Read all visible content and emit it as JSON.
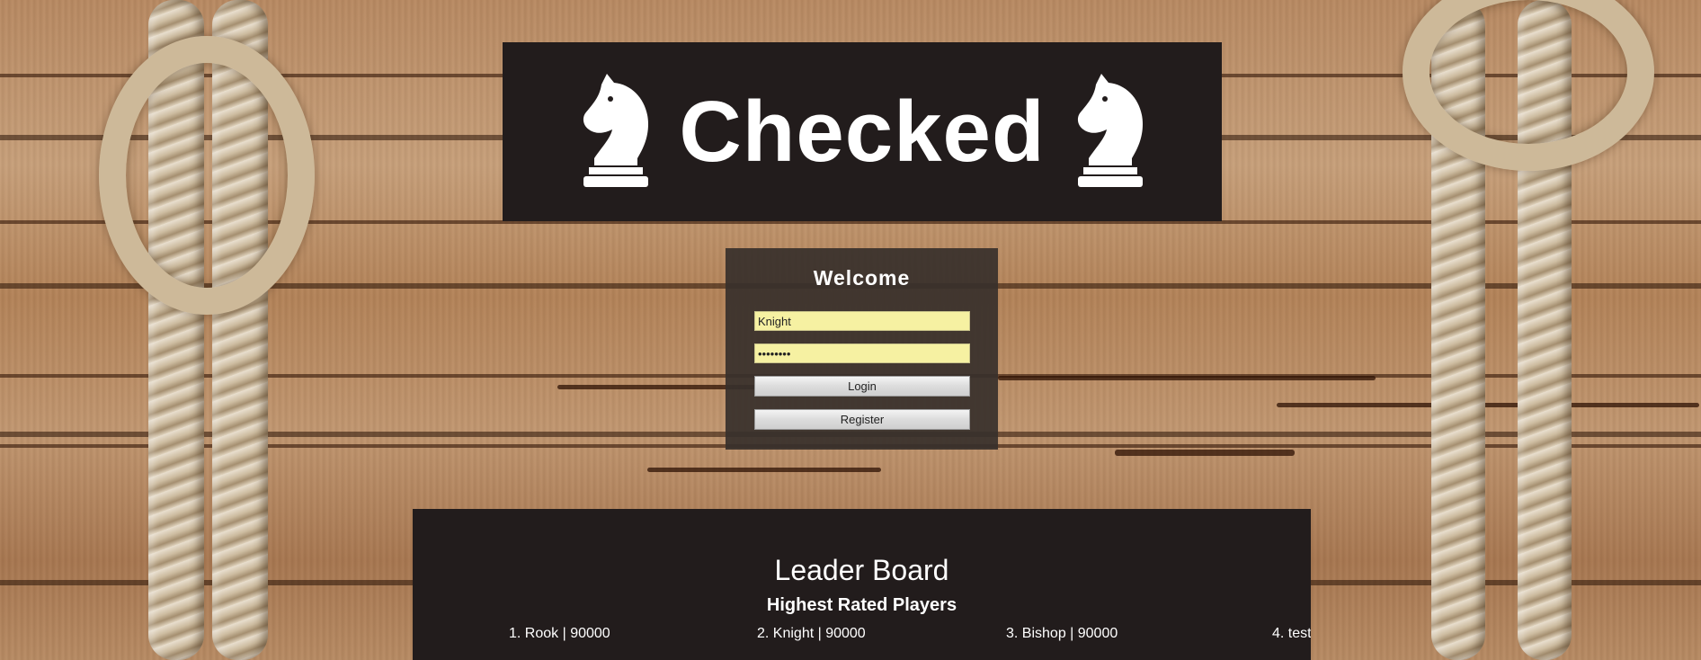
{
  "banner": {
    "title": "Checked"
  },
  "login": {
    "heading": "Welcome",
    "username_value": "Knight",
    "password_value": "••••••••",
    "login_label": "Login",
    "register_label": "Register"
  },
  "leaderboard": {
    "title": "Leader Board",
    "subtitle": "Highest Rated Players",
    "entries": [
      "1. Rook | 90000",
      "2. Knight | 90000",
      "3. Bishop | 90000",
      "4. test"
    ]
  },
  "colors": {
    "panel": "#221c1c",
    "input_bg": "#f6f1a2",
    "text": "#ffffff"
  },
  "icons": {
    "left": "chess-knight-icon",
    "right": "chess-knight-icon"
  }
}
